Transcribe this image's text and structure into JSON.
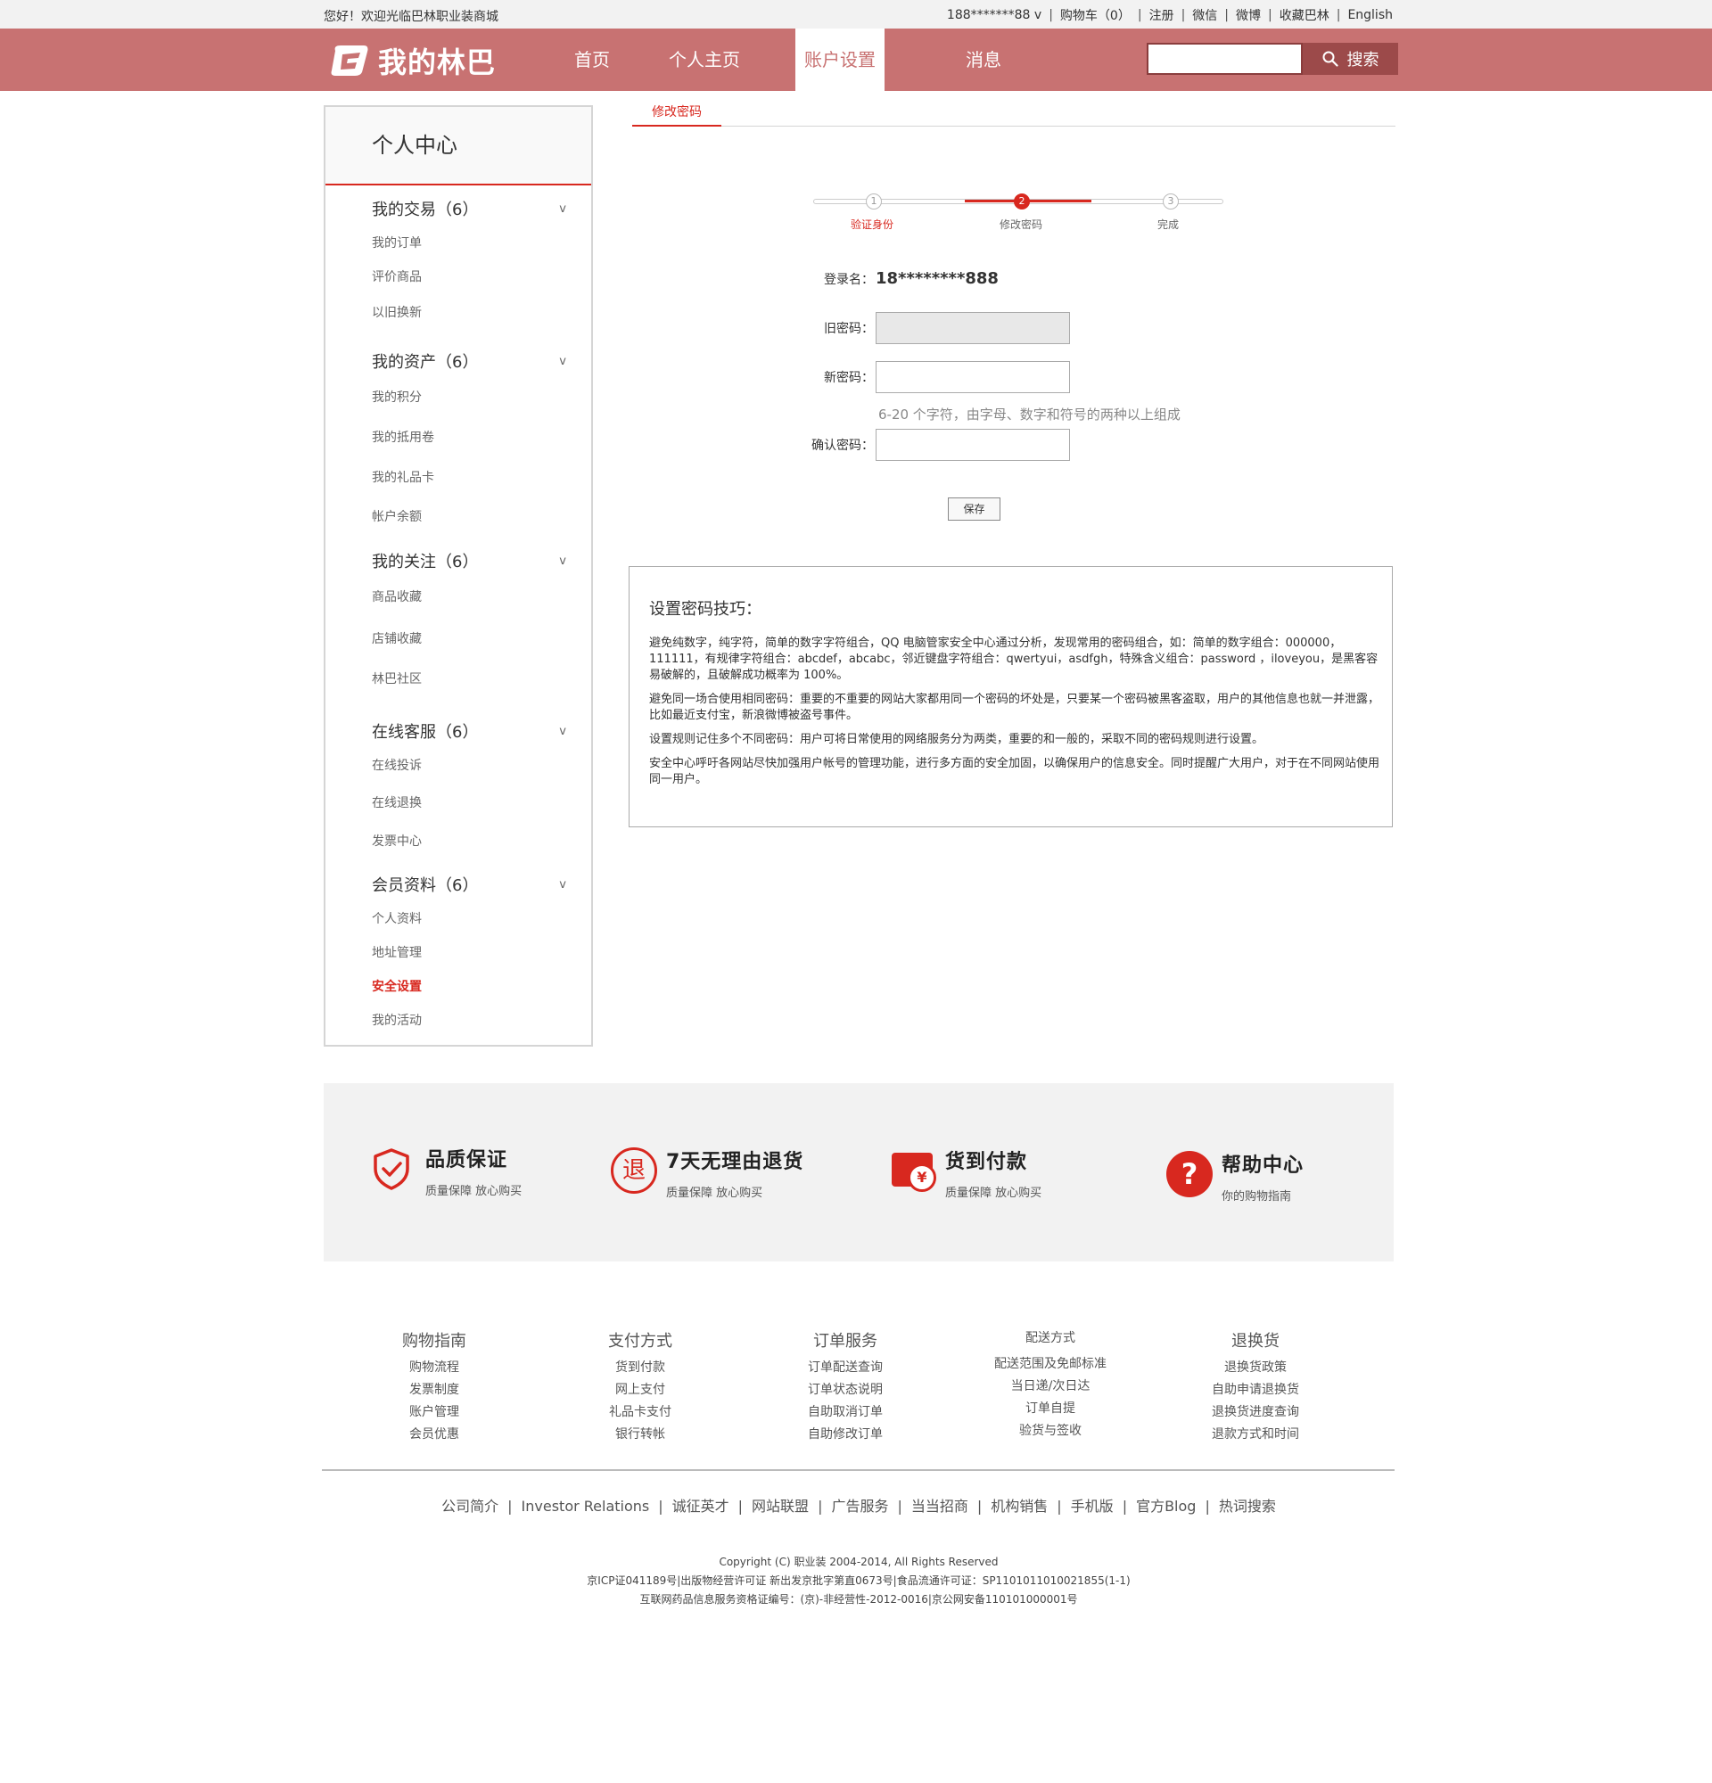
{
  "topbar": {
    "welcome": "您好！欢迎光临巴林职业装商城",
    "account": "188*******88 v",
    "cart": "购物车（0）",
    "register": "注册",
    "wechat": "微信",
    "weibo": "微博",
    "favorite": "收藏巴林",
    "english": "English"
  },
  "header": {
    "logo_text": "我的林巴",
    "nav": [
      "首页",
      "个人主页",
      "账户设置",
      "消息"
    ],
    "active_nav": "账户设置",
    "search_placeholder": "",
    "search_button": "搜索"
  },
  "sidebar": {
    "title": "个人中心",
    "groups": [
      {
        "title": "我的交易（6）",
        "items": [
          "我的订单",
          "评价商品",
          "以旧换新"
        ]
      },
      {
        "title": "我的资产（6）",
        "items": [
          "我的积分",
          "我的抵用卷",
          "我的礼品卡",
          "帐户余额"
        ]
      },
      {
        "title": "我的关注（6）",
        "items": [
          "商品收藏",
          "店铺收藏",
          "林巴社区"
        ]
      },
      {
        "title": "在线客服（6）",
        "items": [
          "在线投诉",
          "在线退换",
          "发票中心"
        ]
      },
      {
        "title": "会员资料（6）",
        "items": [
          "个人资料",
          "地址管理",
          "安全设置",
          "我的活动"
        ]
      }
    ],
    "active_item": "安全设置",
    "chevron": "v"
  },
  "main": {
    "tab": "修改密码",
    "steps": [
      {
        "num": "1",
        "label": "验证身份"
      },
      {
        "num": "2",
        "label": "修改密码"
      },
      {
        "num": "3",
        "label": "完成"
      }
    ],
    "form": {
      "login_label": "登录名：",
      "login_value": "18********888",
      "old_label": "旧密码：",
      "new_label": "新密码：",
      "hint": "6-20 个字符，由字母、数字和符号的两种以上组成",
      "confirm_label": "确认密码：",
      "save": "保存"
    },
    "tips": {
      "title": "设置密码技巧：",
      "paragraphs": [
        "避免纯数字，纯字符，简单的数字字符组合，QQ 电脑管家安全中心通过分析，发现常用的密码组合，如：简单的数字组合：000000，111111，有规律字符组合：abcdef，abcabc，邻近键盘字符组合：qwertyui，asdfgh，特殊含义组合：password ，iloveyou，是黑客容易破解的，且破解成功概率为 100%。",
        "避免同一场合使用相同密码：重要的不重要的网站大家都用同一个密码的坏处是，只要某一个密码被黑客盗取，用户的其他信息也就一并泄露，比如最近支付宝，新浪微博被盗号事件。",
        "设置规则记住多个不同密码：用户可将日常使用的网络服务分为两类，重要的和一般的，采取不同的密码规则进行设置。",
        "安全中心呼吁各网站尽快加强用户帐号的管理功能，进行多方面的安全加固，以确保用户的信息安全。同时提醒广大用户，对于在不同网站使用同一用户。"
      ]
    }
  },
  "guarantees": [
    {
      "title": "品质保证",
      "sub": "质量保障 放心购买",
      "icon": "shield-check-icon"
    },
    {
      "title": "7天无理由退货",
      "sub": "质量保障 放心购买",
      "icon": "return-icon",
      "glyph": "退"
    },
    {
      "title": "货到付款",
      "sub": "质量保障 放心购买",
      "icon": "wallet-yuan-icon",
      "glyph": "¥"
    },
    {
      "title": "帮助中心",
      "sub": "你的购物指南",
      "icon": "help-icon",
      "glyph": "?"
    }
  ],
  "footer": {
    "columns": [
      {
        "title": "购物指南",
        "links": [
          "购物流程",
          "发票制度",
          "账户管理",
          "会员优惠"
        ]
      },
      {
        "title": "支付方式",
        "links": [
          "货到付款",
          "网上支付",
          "礼品卡支付",
          "银行转帐"
        ]
      },
      {
        "title": "订单服务",
        "links": [
          "订单配送查询",
          "订单状态说明",
          "自助取消订单",
          "自助修改订单"
        ]
      },
      {
        "title": "配送方式",
        "links": [
          "配送范围及免邮标准",
          "当日递/次日达",
          "订单自提",
          "验货与签收"
        ]
      },
      {
        "title": "退换货",
        "links": [
          "退换货政策",
          "自助申请退换货",
          "退换货进度查询",
          "退款方式和时间"
        ]
      }
    ],
    "about_links": [
      "公司简介",
      "Investor Relations",
      "诚征英才",
      "网站联盟",
      "广告服务",
      "当当招商",
      "机构销售",
      "手机版",
      "官方Blog",
      "热词搜索"
    ],
    "copyright": [
      "Copyright (C) 职业装 2004-2014, All Rights Reserved",
      "京ICP证041189号|出版物经营许可证 新出发京批字第直0673号|食品流通许可证：SP1101011010021855(1-1)",
      "互联网药品信息服务资格证编号：(京)-非经营性-2012-0016|京公网安备110101000001号"
    ]
  },
  "colors": {
    "brand": "#c87272",
    "accent": "#d8281f",
    "search_button": "#9c4a4a"
  }
}
